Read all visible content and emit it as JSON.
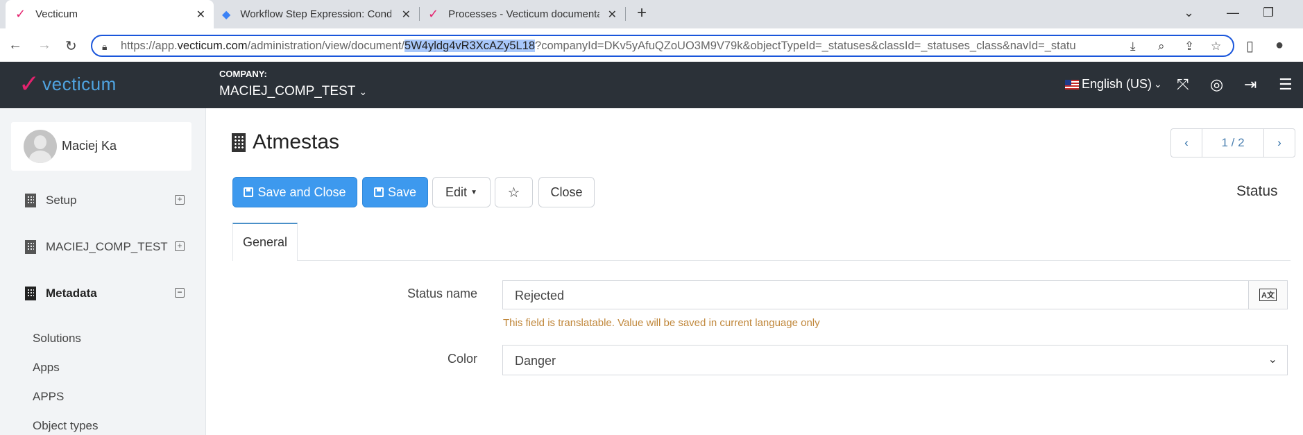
{
  "browser": {
    "tabs": [
      {
        "title": "Vecticum"
      },
      {
        "title": "Workflow Step Expression: Condi"
      },
      {
        "title": "Processes - Vecticum documenta"
      }
    ],
    "url_prefix": "https://app.",
    "url_domain": "vecticum.com",
    "url_path": "/administration/view/document/",
    "url_selected": "5W4yldg4vR3XcAZy5L18",
    "url_rest": "?companyId=DKv5yAfuQZoUO3M9V79k&objectTypeId=_statuses&classId=_statuses_class&navId=_statu"
  },
  "header": {
    "logo_text": "vecticum",
    "company_label": "COMPANY:",
    "company_value": "MACIEJ_COMP_TEST",
    "language": "English (US)"
  },
  "sidebar": {
    "user_name": "Maciej Ka",
    "items": [
      {
        "label": "Setup",
        "toggle": "+"
      },
      {
        "label": "MACIEJ_COMP_TEST",
        "toggle": "+"
      },
      {
        "label": "Metadata",
        "toggle": "−"
      }
    ],
    "sub_items": [
      "Solutions",
      "Apps",
      "APPS",
      "Object types"
    ]
  },
  "main": {
    "title": "Atmestas",
    "pager": "1 / 2",
    "buttons": {
      "save_close": "Save and Close",
      "save": "Save",
      "edit": "Edit",
      "close": "Close"
    },
    "status_label": "Status",
    "tab": "General",
    "fields": {
      "status_name_label": "Status name",
      "status_name_value": "Rejected",
      "hint": "This field is translatable. Value will be saved in current language only",
      "color_label": "Color",
      "color_value": "Danger"
    }
  },
  "colors": {
    "header_bg": "#2b3138",
    "primary_button": "#3d99ee",
    "logo_v": "#e4226e",
    "logo_text": "#4fa3e0",
    "hint": "#c0873b"
  }
}
